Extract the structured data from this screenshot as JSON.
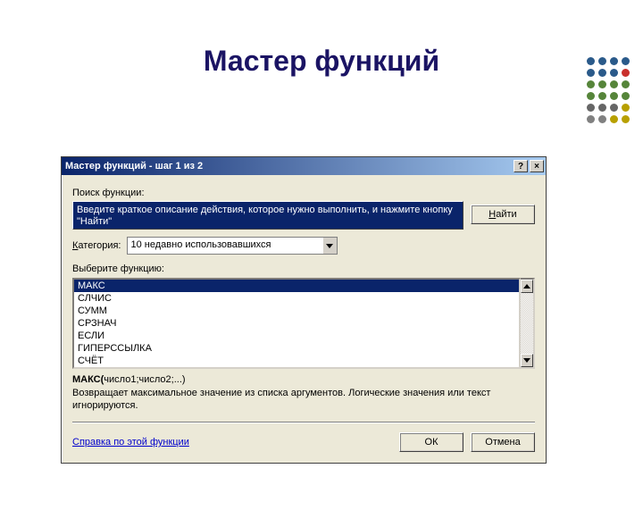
{
  "slide": {
    "title": "Мастер функций"
  },
  "dialog": {
    "title": "Мастер функций - шаг 1 из 2",
    "help_btn": "?",
    "close_btn": "×",
    "search_label": "Поиск функции:",
    "search_text": "Введите краткое описание действия, которое нужно выполнить, и нажмите кнопку \"Найти\"",
    "find_btn": "Найти",
    "category_label": "Категория:",
    "category_value": "10 недавно использовавшихся",
    "select_label": "Выберите функцию:",
    "functions": [
      "МАКС",
      "СЛЧИС",
      "СУММ",
      "СРЗНАЧ",
      "ЕСЛИ",
      "ГИПЕРССЫЛКА",
      "СЧЁТ"
    ],
    "signature_name": "МАКС(",
    "signature_args": "число1;число2;...)",
    "description": "Возвращает максимальное значение из списка аргументов. Логические значения или текст игнорируются.",
    "help_link": "Справка по этой функции",
    "ok": "ОК",
    "cancel": "Отмена"
  },
  "dot_colors": [
    "#2a5a8a",
    "#2a5a8a",
    "#2a5a8a",
    "#2a5a8a",
    "#2a5a8a",
    "#2a5a8a",
    "#2a5a8a",
    "#c9302c",
    "#56853a",
    "#56853a",
    "#56853a",
    "#56853a",
    "#56853a",
    "#56853a",
    "#56853a",
    "#56853a",
    "#666",
    "#666",
    "#666",
    "#b8a000",
    "#808080",
    "#808080",
    "#b8a000",
    "#b8a000"
  ]
}
